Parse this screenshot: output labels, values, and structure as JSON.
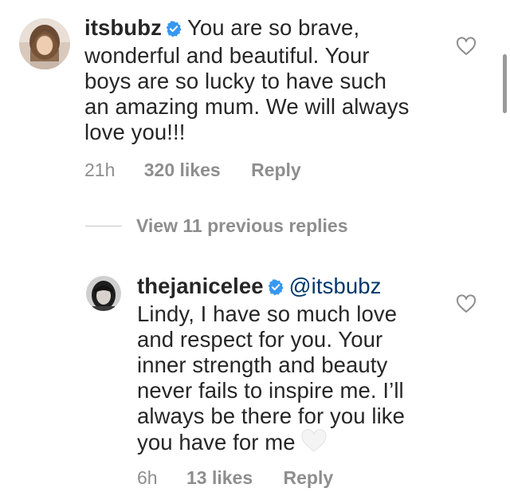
{
  "comments": [
    {
      "username": "itsbubz",
      "verified": true,
      "mention": "",
      "lines": [
        "You are so brave,",
        "wonderful and beautiful. Your",
        "boys are so lucky to have such",
        "an amazing mum. We will always",
        "love you!!!"
      ],
      "time": "21h",
      "likes": "320 likes",
      "reply": "Reply",
      "avatar_icon": "user-avatar-photo",
      "like_icon": "heart-outline-icon"
    },
    {
      "username": "thejanicelee",
      "verified": true,
      "mention": "@itsbubz",
      "lines": [
        "Lindy, I have so much love",
        "and respect for you. Your",
        "inner strength and beauty",
        "never fails to inspire me. I’ll",
        "always be there for you like",
        "you have for me"
      ],
      "emoji": "white-heart",
      "time": "6h",
      "likes": "13 likes",
      "reply": "Reply",
      "avatar_icon": "user-avatar-photo",
      "like_icon": "heart-outline-icon"
    }
  ],
  "view_replies": "View 11 previous replies",
  "colors": {
    "text": "#262626",
    "secondary": "#8e8e8e",
    "verified": "#3897f0",
    "mention": "#00376b"
  }
}
